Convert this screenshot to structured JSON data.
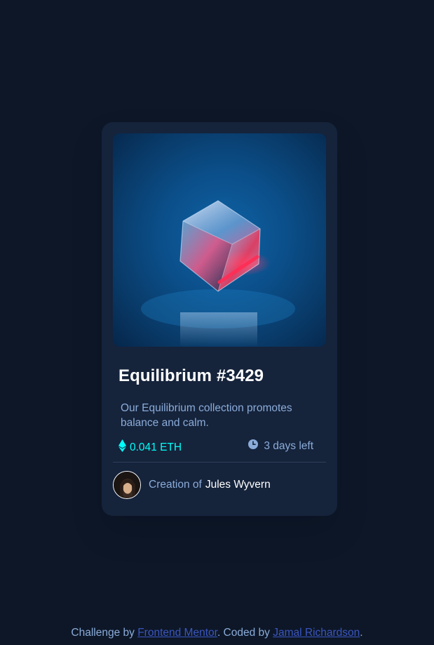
{
  "card": {
    "title": "Equilibrium #3429",
    "description": "Our Equilibrium collection promotes balance and calm.",
    "price": "0.041 ETH",
    "time_left": "3 days left",
    "creator_prefix": "Creation of",
    "creator_name": "Jules Wyvern"
  },
  "footer": {
    "prefix": "Challenge by",
    "mentor_link": "Frontend Mentor",
    "middle": ". Coded by",
    "author_link": "Jamal Richardson",
    "suffix": "."
  },
  "colors": {
    "background": "#0d1728",
    "card": "#15233b",
    "accent_cyan": "#00fff8",
    "soft_blue": "#8bacd9",
    "link_blue": "#3b56bf"
  },
  "icons": [
    "ethereum-icon",
    "clock-icon"
  ]
}
